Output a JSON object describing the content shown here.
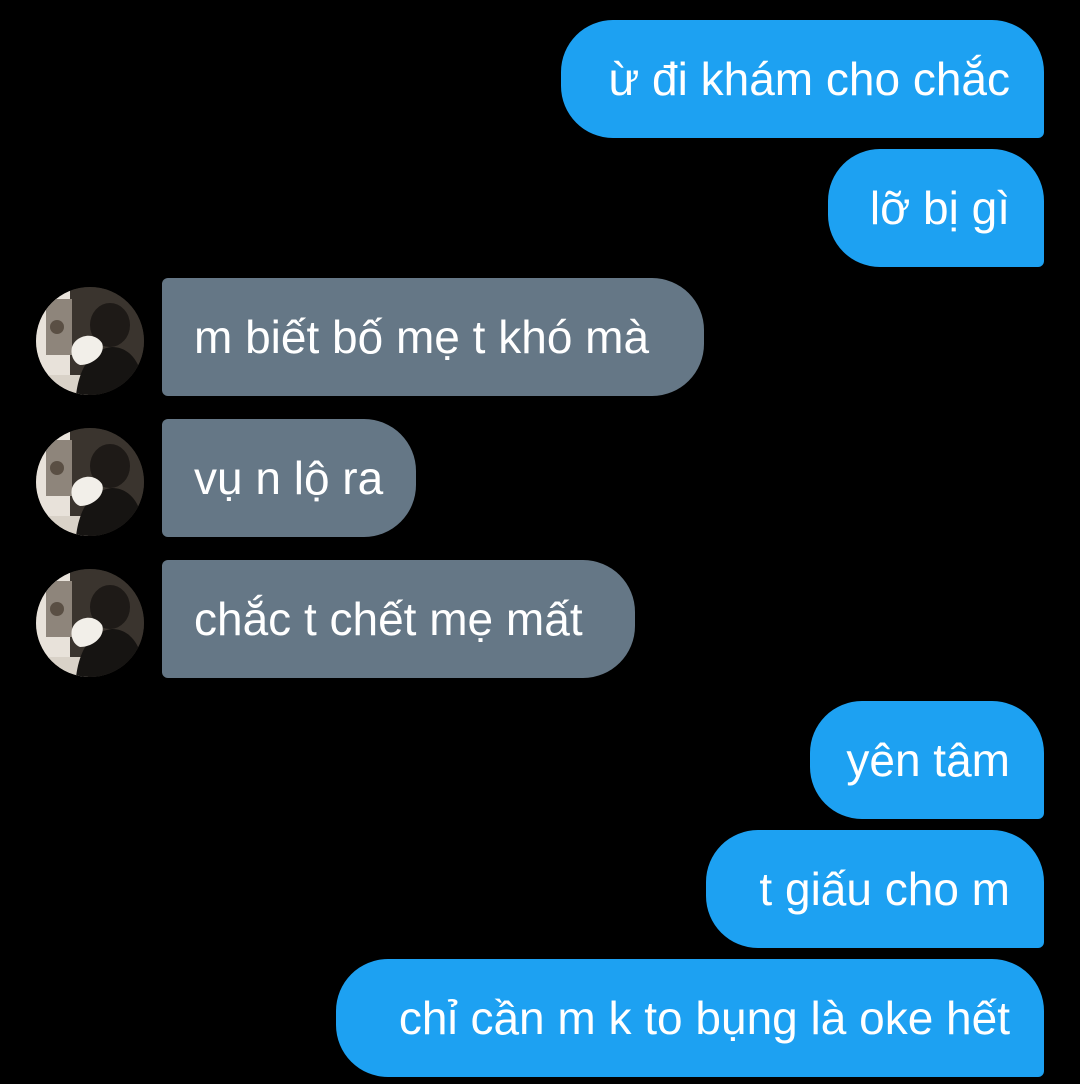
{
  "conversation": {
    "messages": [
      {
        "direction": "sent",
        "text": "ừ đi khám cho chắc"
      },
      {
        "direction": "sent",
        "text": "lỡ bị gì"
      },
      {
        "direction": "received",
        "text": "m biết bố mẹ t khó mà"
      },
      {
        "direction": "received",
        "text": "vụ n lộ ra"
      },
      {
        "direction": "received",
        "text": "chắc t chết mẹ mất"
      },
      {
        "direction": "sent",
        "text": "yên tâm"
      },
      {
        "direction": "sent",
        "text": "t giấu cho m"
      },
      {
        "direction": "sent",
        "text": "chỉ cần m k to bụng là oke hết"
      }
    ]
  },
  "colors": {
    "background": "#000000",
    "sent_bubble": "#1da1f2",
    "received_bubble": "#657786",
    "text": "#ffffff"
  },
  "icons": {
    "avatar": "contact-avatar-photo"
  }
}
